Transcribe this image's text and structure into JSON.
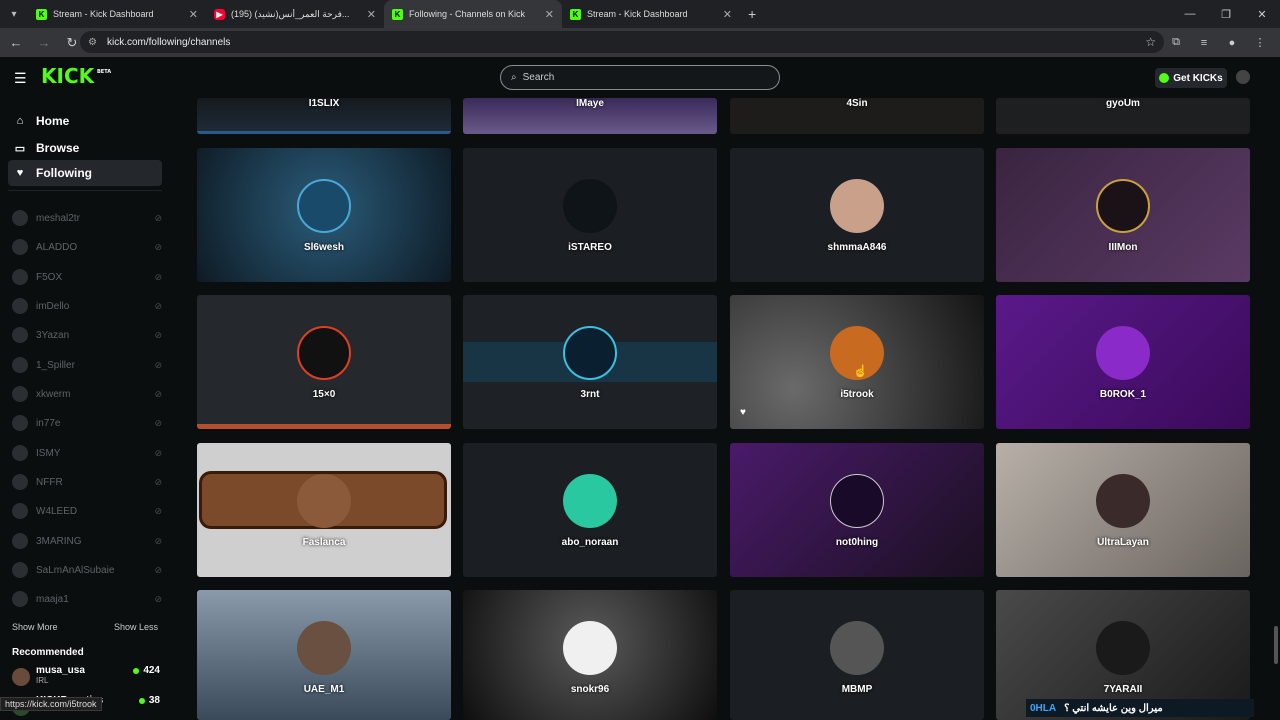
{
  "browser": {
    "tabs": [
      {
        "title": "Stream - Kick Dashboard",
        "favicon": "kick",
        "active": false
      },
      {
        "title": "(195) (نشيد)فرحة العمر_أنس...",
        "favicon": "youtube",
        "active": false
      },
      {
        "title": "Following - Channels on Kick",
        "favicon": "kick",
        "active": true
      },
      {
        "title": "Stream - Kick Dashboard",
        "favicon": "kick",
        "active": false
      }
    ],
    "url": "kick.com/following/channels",
    "status_url": "https://kick.com/i5trook"
  },
  "header": {
    "logo": "KICK",
    "logo_badge": "BETA",
    "search_placeholder": "Search",
    "get_kicks_label": "Get KICKs"
  },
  "sidebar": {
    "nav": [
      {
        "label": "Home",
        "icon": "home-icon"
      },
      {
        "label": "Browse",
        "icon": "browse-icon"
      },
      {
        "label": "Following",
        "icon": "heart-icon",
        "active": true
      }
    ],
    "following": [
      "meshal2tr",
      "ALADDO",
      "F5OX",
      "imDello",
      "3Yazan",
      "1_Spiller",
      "xkwerm",
      "in77e",
      "ISMY",
      "NFFR",
      "W4LEED",
      "3MARING",
      "SaLmAnAlSubaie",
      "maaja1"
    ],
    "show_more": "Show More",
    "show_less": "Show Less",
    "recommended_title": "Recommended",
    "recommended": [
      {
        "name": "musa_usa",
        "category": "IRL",
        "viewers": "424"
      },
      {
        "name": "KICKBounties",
        "category": "",
        "viewers": "38"
      }
    ]
  },
  "channels": [
    {
      "name": "I1SLIX",
      "row": 0
    },
    {
      "name": "IMaye",
      "row": 0
    },
    {
      "name": "4Sin",
      "row": 0
    },
    {
      "name": "gyoUm",
      "row": 0
    },
    {
      "name": "Sl6wesh",
      "row": 1
    },
    {
      "name": "iSTAREO",
      "row": 1
    },
    {
      "name": "shmmaA846",
      "row": 1
    },
    {
      "name": "IIIMon",
      "row": 1
    },
    {
      "name": "15×0",
      "row": 2
    },
    {
      "name": "3rnt",
      "row": 2
    },
    {
      "name": "i5trook",
      "row": 2
    },
    {
      "name": "B0ROK_1",
      "row": 2
    },
    {
      "name": "Faslanca",
      "row": 3
    },
    {
      "name": "abo_noraan",
      "row": 3
    },
    {
      "name": "not0hing",
      "row": 3
    },
    {
      "name": "UltraLayan",
      "row": 3
    },
    {
      "name": "UAE_M1",
      "row": 4
    },
    {
      "name": "snokr96",
      "row": 4
    },
    {
      "name": "MBMP",
      "row": 4
    },
    {
      "name": "7YARAII",
      "row": 4
    }
  ],
  "ticker": {
    "brand": "0HLA",
    "message": "ميرال وين عايشه انتي ؟"
  },
  "colors": {
    "accent": "#53fc18",
    "background": "#0b0e0f",
    "card": "#1b1e22"
  }
}
